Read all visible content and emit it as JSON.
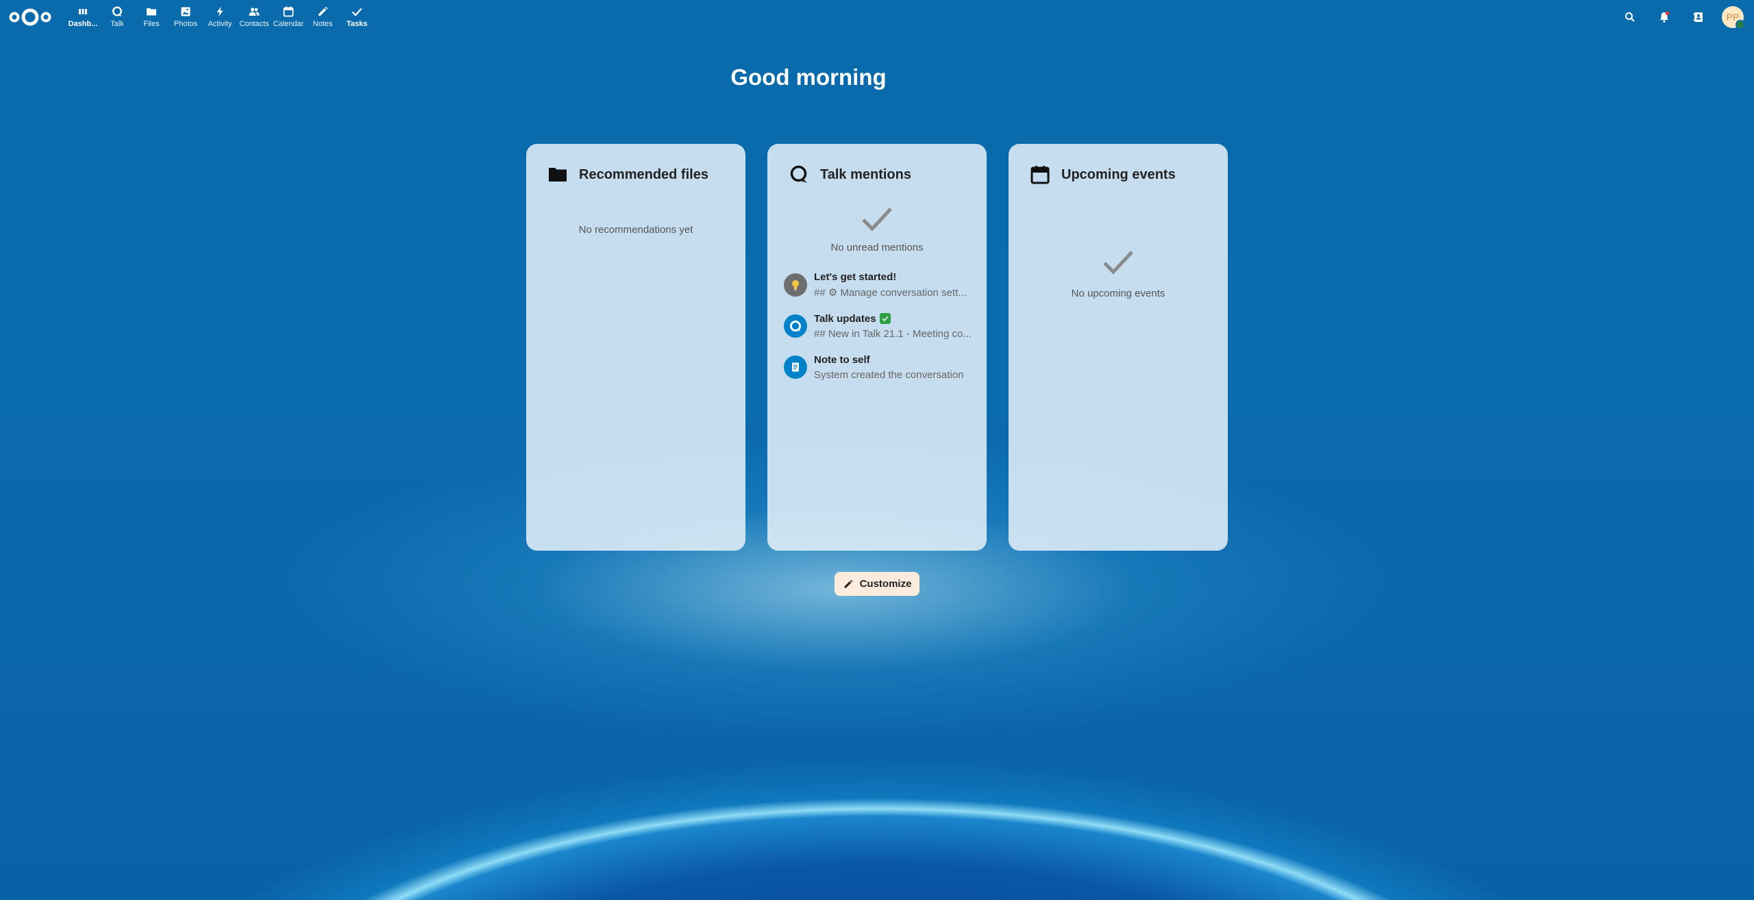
{
  "colors": {
    "background_top": "#0a6bac",
    "panel_bg": "#e9f3fa",
    "customize_bg": "#fdecde",
    "status_online": "#2d7b41",
    "avatar_bg": "#ffe7c4",
    "avatar_fg": "#c98a35"
  },
  "header": {
    "logo_icon": "nextcloud-logo",
    "apps": [
      {
        "label": "Dashb...",
        "icon": "dashboard-icon",
        "active": true
      },
      {
        "label": "Talk",
        "icon": "talk-icon",
        "active": false
      },
      {
        "label": "Files",
        "icon": "folder-icon",
        "active": false
      },
      {
        "label": "Photos",
        "icon": "image-icon",
        "active": false
      },
      {
        "label": "Activity",
        "icon": "lightning-icon",
        "active": false
      },
      {
        "label": "Contacts",
        "icon": "contacts-icon",
        "active": false
      },
      {
        "label": "Calendar",
        "icon": "calendar-icon",
        "active": false
      },
      {
        "label": "Notes",
        "icon": "pencil-icon",
        "active": false
      },
      {
        "label": "Tasks",
        "icon": "checkmark-icon",
        "active": true
      }
    ],
    "right": {
      "search_icon": "search-icon",
      "notifications_icon": "bell-icon",
      "contacts_menu_icon": "contacts-menu-icon",
      "avatar_initials": "PP"
    }
  },
  "greeting": "Good morning",
  "panels": {
    "files": {
      "title": "Recommended files",
      "icon": "folder-icon",
      "empty_text": "No recommendations yet"
    },
    "talk": {
      "title": "Talk mentions",
      "icon": "talk-icon",
      "empty_text": "No unread mentions",
      "conversations": [
        {
          "name": "Let's get started!",
          "subline": "## ⚙ Manage conversation sett...",
          "avatar_icon": "lightbulb-icon"
        },
        {
          "name": "Talk updates",
          "subline": "## New in Talk 21.1 - Meeting co...",
          "avatar_icon": "talk-icon",
          "badge": "green-check-icon"
        },
        {
          "name": "Note to self",
          "subline": "System created the conversation",
          "avatar_icon": "notepad-icon"
        }
      ]
    },
    "events": {
      "title": "Upcoming events",
      "icon": "calendar-icon",
      "empty_text": "No upcoming events"
    }
  },
  "customize": {
    "label": "Customize",
    "icon": "pencil-icon"
  }
}
